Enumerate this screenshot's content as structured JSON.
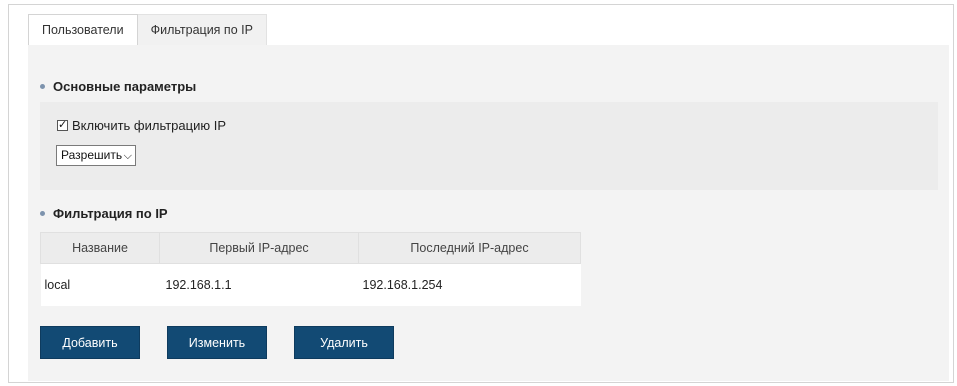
{
  "tabs": [
    {
      "label": "Пользователи"
    },
    {
      "label": "Фильтрация по IP"
    }
  ],
  "basic": {
    "title": "Основные параметры",
    "enable_label": "Включить фильтрацию IP",
    "enable_checked": true,
    "mode_select": "Разрешить"
  },
  "filter": {
    "title": "Фильтрация по IP",
    "columns": [
      "Название",
      "Первый IP-адрес",
      "Последний IP-адрес"
    ],
    "rows": [
      [
        "local",
        "192.168.1.1",
        "192.168.1.254"
      ]
    ]
  },
  "buttons": {
    "add": "Добавить",
    "edit": "Изменить",
    "delete": "Удалить"
  },
  "colors": {
    "button_bg": "#124a74",
    "bullet": "#7d93ad"
  }
}
